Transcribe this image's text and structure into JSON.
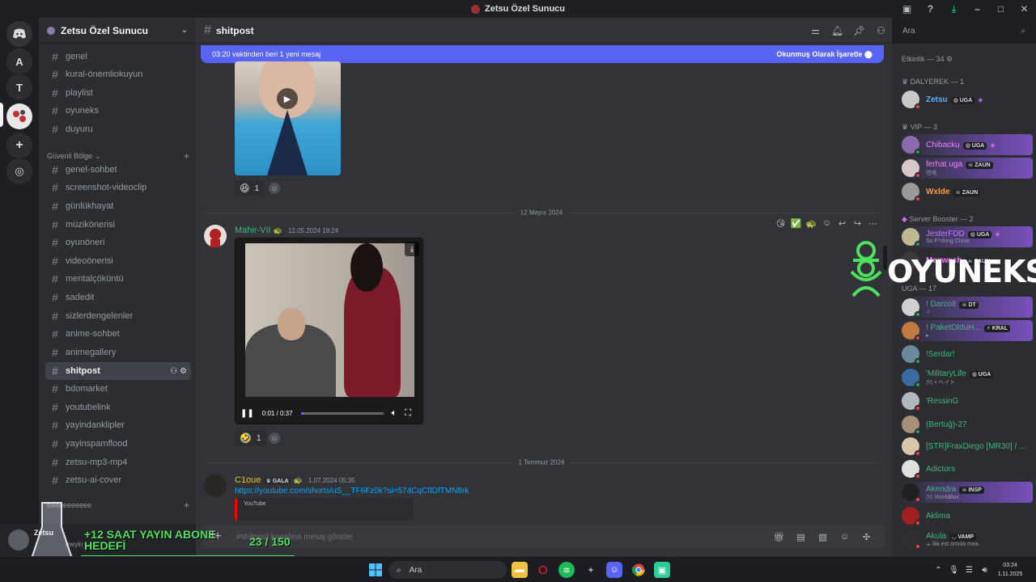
{
  "window": {
    "title": "Zetsu Özel Sunucu"
  },
  "rail": {
    "servers": [
      "A",
      "T"
    ]
  },
  "guild": {
    "name": "Zetsu Özel Sunucu"
  },
  "channels": {
    "top": [
      "genel",
      "kural-önemliokuyun",
      "playlist",
      "oyuneks",
      "duyuru"
    ],
    "category": "Güvenli Bölge",
    "list": [
      "genel-sohbet",
      "screenshot-videoclip",
      "günlükhayat",
      "müzikönerisi",
      "oyunöneri",
      "videoönerisi",
      "mentalçöküntü",
      "sadedit",
      "sizlerdengelenler",
      "anime-sohbet",
      "animegallery",
      "shitpost",
      "bdomarket",
      "youtubelink",
      "yayindanklipler",
      "yayinspamflood",
      "zetsu-mp3-mp4",
      "zetsu-ai-cover"
    ],
    "active": "shitpost",
    "partial_category": "eeeeeeeeeee"
  },
  "user_panel": {
    "status_text": "meyin"
  },
  "stream_overlay": {
    "title": "+12 SAAT YAYIN ABONE HEDEFİ",
    "current": "23",
    "separator": " / ",
    "goal": "150",
    "progress_fraction": 0.153,
    "flask_label": "Zetsu"
  },
  "chat_header": {
    "channel": "shitpost"
  },
  "new_banner": {
    "text": "03:20 vaktinden beri 1 yeni mesaj",
    "action": "Okunmuş Olarak İşaretle"
  },
  "messages": {
    "m1": {
      "reaction_count": "1"
    },
    "date1": "12 Mayıs 2024",
    "m2": {
      "author": "Mahir-VII",
      "author_color": "#43b581",
      "timestamp": "12.05.2024 19:24",
      "video_time": "0:01 / 0:37",
      "video_progress_fraction": 0.04,
      "reaction_count": "1"
    },
    "date2": "1 Temmuz 2024",
    "m3": {
      "author": "C1oue",
      "author_color": "#f1c40f",
      "tag": "GALA",
      "timestamp": "1.07.2024 05:35",
      "link": "https://youtube.com/shorts/uS__TF6Fz0k?si=574CqCfIDfTMN8rk",
      "embed_provider": "YouTube"
    }
  },
  "composer": {
    "placeholder": "#shitpost kanalına mesaj gönder"
  },
  "search": {
    "placeholder": "Ara"
  },
  "members": {
    "activity_header": "Etkinlik — 34",
    "groups": [
      {
        "name": "DALYEREK — 1",
        "members": [
          {
            "name": "Zetsu",
            "tag": "UGA",
            "color": "#5ab0ff"
          }
        ]
      },
      {
        "name": "VIP — 3",
        "members": [
          {
            "name": "Chibacku",
            "tag": "UGA",
            "color": "#f47fff"
          },
          {
            "name": "ferhat uga",
            "tag": "ZAUN",
            "sub": "영애",
            "color": "#f47fff"
          },
          {
            "name": "Wxlde",
            "tag": "ZAUN",
            "color": "#ff9a3c"
          }
        ]
      },
      {
        "name": "Server Booster — 2",
        "members": [
          {
            "name": "JesterFDD",
            "tag": "UGA",
            "sub": "So F*cking Close",
            "color": "#c27cff"
          },
          {
            "name": "Maxwesh",
            "tag": "ZAUN",
            "sub": "",
            "color": "#ff73fa"
          }
        ]
      },
      {
        "name": "UGA — 17",
        "members": [
          {
            "name": "! Darcolt",
            "tag": "DT",
            "sub": "",
            "color": "#43b581"
          },
          {
            "name": "! PaketOlduH...",
            "tag": "KRAL",
            "sub": "",
            "color": "#43b581"
          },
          {
            "name": "!Serdar!",
            "color": "#43b581"
          },
          {
            "name": "'MilitaryLife",
            "tag": "UGA",
            "sub": "• ヘイト",
            "color": "#43b581"
          },
          {
            "name": "'RessinG",
            "color": "#43b581"
          },
          {
            "name": "(Bertuğ)-27",
            "color": "#43b581"
          },
          {
            "name": "[STR]FraxDiego [MR30] / ...",
            "color": "#43b581"
          },
          {
            "name": "Adictors",
            "color": "#43b581"
          },
          {
            "name": "Akendra",
            "tag": "INSP",
            "sub": "WorldBox",
            "color": "#43b581"
          },
          {
            "name": "Aklima",
            "color": "#43b581"
          },
          {
            "name": "Akula",
            "tag": "VAMP",
            "sub": "illa est omnia mea.",
            "color": "#43b581"
          }
        ]
      }
    ]
  },
  "oyuneks_logo": {
    "text": "OYUNEKS"
  },
  "taskbar": {
    "search": "Ara",
    "time": "03:24",
    "date": "1.11.2025"
  },
  "colors": {
    "blurple": "#5865f2",
    "green": "#23a559",
    "dnd": "#f23f43",
    "idle": "#f0b232",
    "overlay_green": "#50e060"
  }
}
